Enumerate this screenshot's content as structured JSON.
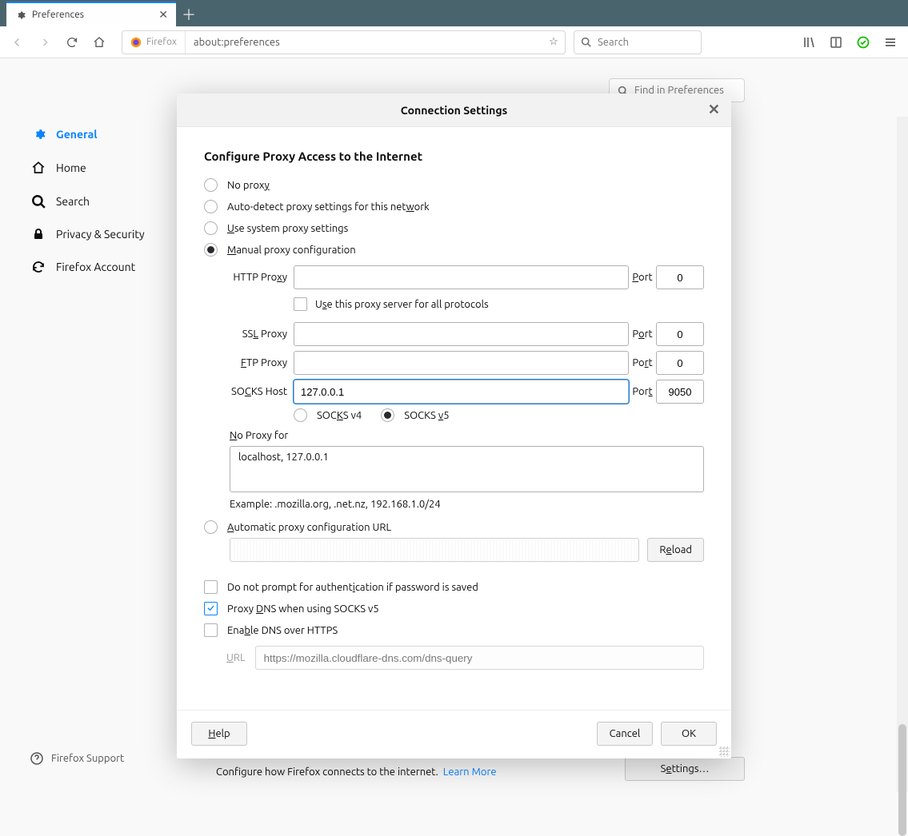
{
  "tab": {
    "title": "Preferences"
  },
  "navbar": {
    "identity_brand": "Firefox",
    "url": "about:preferences",
    "search_placeholder": "Search"
  },
  "prefs": {
    "find_placeholder": "Find in Preferences",
    "sidebar": {
      "general": "General",
      "home": "Home",
      "search": "Search",
      "privacy": "Privacy & Security",
      "account": "Firefox Account"
    },
    "support": "Firefox Support",
    "bottom_text": "Configure how Firefox connects to the internet.",
    "learn_more": "Learn More",
    "settings_btn": "Settings…"
  },
  "dialog": {
    "title": "Connection Settings",
    "section_title": "Configure Proxy Access to the Internet",
    "radio": {
      "none": "No proxy",
      "auto": "Auto-detect proxy settings for this network",
      "system": "Use system proxy settings",
      "manual": "Manual proxy configuration",
      "pac": "Automatic proxy configuration URL"
    },
    "labels": {
      "http": "HTTP Proxy",
      "use_all": "Use this proxy server for all protocols",
      "ssl": "SSL Proxy",
      "ftp": "FTP Proxy",
      "socks": "SOCKS Host",
      "port": "Port",
      "socks4": "SOCKS v4",
      "socks5": "SOCKS v5",
      "noproxy": "No Proxy for",
      "example": "Example: .mozilla.org, .net.nz, 192.168.1.0/24",
      "reload": "Reload",
      "no_auth_prompt": "Do not prompt for authentication if password is saved",
      "proxy_dns_socks5": "Proxy DNS when using SOCKS v5",
      "enable_doh": "Enable DNS over HTTPS",
      "url": "URL"
    },
    "values": {
      "http_host": "",
      "http_port": "0",
      "ssl_host": "",
      "ssl_port": "0",
      "ftp_host": "",
      "ftp_port": "0",
      "socks_host": "127.0.0.1",
      "socks_port": "9050",
      "noproxy": "localhost, 127.0.0.1",
      "pac_url": "",
      "doh_url": "https://mozilla.cloudflare-dns.com/dns-query"
    },
    "buttons": {
      "help": "Help",
      "cancel": "Cancel",
      "ok": "OK"
    }
  }
}
